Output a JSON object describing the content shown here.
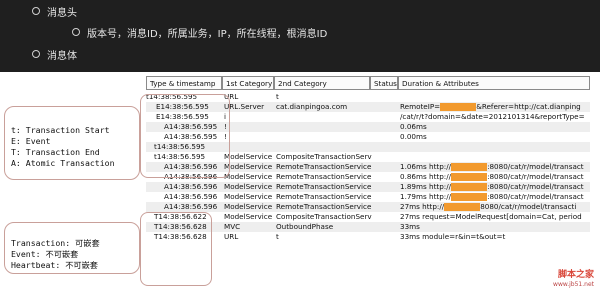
{
  "slide": {
    "bullet1": "消息头",
    "bullet2": "版本号，消息ID，所属业务，IP，所在线程，根消息ID",
    "bullet3": "消息体"
  },
  "table": {
    "headers": [
      "Type & timestamp",
      "1st Category",
      "2nd Category",
      "Status",
      "Duration & Attributes"
    ],
    "rows": [
      {
        "ts": "t14:38:56.595",
        "c1": "URL",
        "c2": "t",
        "st": "",
        "da": ""
      },
      {
        "ts": "E14:38:56.595",
        "c1": "URL.Server",
        "c2": "cat.dianpingoa.com",
        "st": "",
        "da": "RemoteIP=",
        "mask": true,
        "da2": "&Referer=http://cat.dianping"
      },
      {
        "ts": "E14:38:56.595",
        "c1": "i",
        "c2": "",
        "st": "",
        "da": "/cat/r/t?domain=&date=2012101314&reportType="
      },
      {
        "ts": "A14:38:56.595",
        "c1": "!",
        "c2": "",
        "st": "",
        "da": "0.06ms"
      },
      {
        "ts": "A14:38:56.595",
        "c1": "!",
        "c2": "",
        "st": "",
        "da": "0.00ms"
      },
      {
        "ts": "t14:38:56.595",
        "c1": "",
        "c2": "",
        "st": "",
        "da": ""
      },
      {
        "ts": "t14:38:56.595",
        "c1": "ModelService",
        "c2": "CompositeTransactionService",
        "st": "",
        "da": ""
      },
      {
        "ts": "A14:38:56.596",
        "c1": "ModelService",
        "c2": "RemoteTransactionService",
        "st": "",
        "da": "1.06ms http://",
        "mask": true,
        "da2": ":8080/cat/r/model/transact"
      },
      {
        "ts": "A14:38:56.596",
        "c1": "ModelService",
        "c2": "RemoteTransactionService",
        "st": "",
        "da": "0.86ms http://",
        "mask": true,
        "da2": ":8080/cat/r/model/transact"
      },
      {
        "ts": "A14:38:56.596",
        "c1": "ModelService",
        "c2": "RemoteTransactionService",
        "st": "",
        "da": "1.89ms http://",
        "mask": true,
        "da2": ":8080/cat/r/model/transact"
      },
      {
        "ts": "A14:38:56.596",
        "c1": "ModelService",
        "c2": "RemoteTransactionService",
        "st": "",
        "da": "1.79ms http://",
        "mask": true,
        "da2": ":8080/cat/r/model/transact"
      },
      {
        "ts": "A14:38:56.596",
        "c1": "ModelService",
        "c2": "RemoteTransactionService",
        "st": "",
        "da": "27ms http://",
        "mask": true,
        "da2": "8080/cat/r/model/transacti"
      },
      {
        "ts": "T14:38:56.622",
        "c1": "ModelService",
        "c2": "CompositeTransactionService",
        "st": "",
        "da": "27ms request=ModelRequest[domain=Cat, period"
      },
      {
        "ts": "T14:38:56.628",
        "c1": "MVC",
        "c2": "OutboundPhase",
        "st": "",
        "da": "33ms"
      },
      {
        "ts": "T14:38:56.628",
        "c1": "URL",
        "c2": "t",
        "st": "",
        "da": "33ms module=r&in=t&out=t"
      }
    ]
  },
  "legend": {
    "l1": "t: Transaction Start",
    "l2": "E: Event",
    "l3": "T: Transaction End",
    "l4": "A: Atomic Transaction"
  },
  "legend2": {
    "l1": "Transaction: 可嵌套",
    "l2": "Event: 不可嵌套",
    "l3": "Heartbeat: 不可嵌套"
  },
  "watermark": {
    "line1": "脚本之家",
    "line2": "www.jb51.net"
  },
  "colors": {
    "mask": "#f29a2e",
    "top_bg": "#1f1f1f",
    "callout": "#c9a09a"
  }
}
